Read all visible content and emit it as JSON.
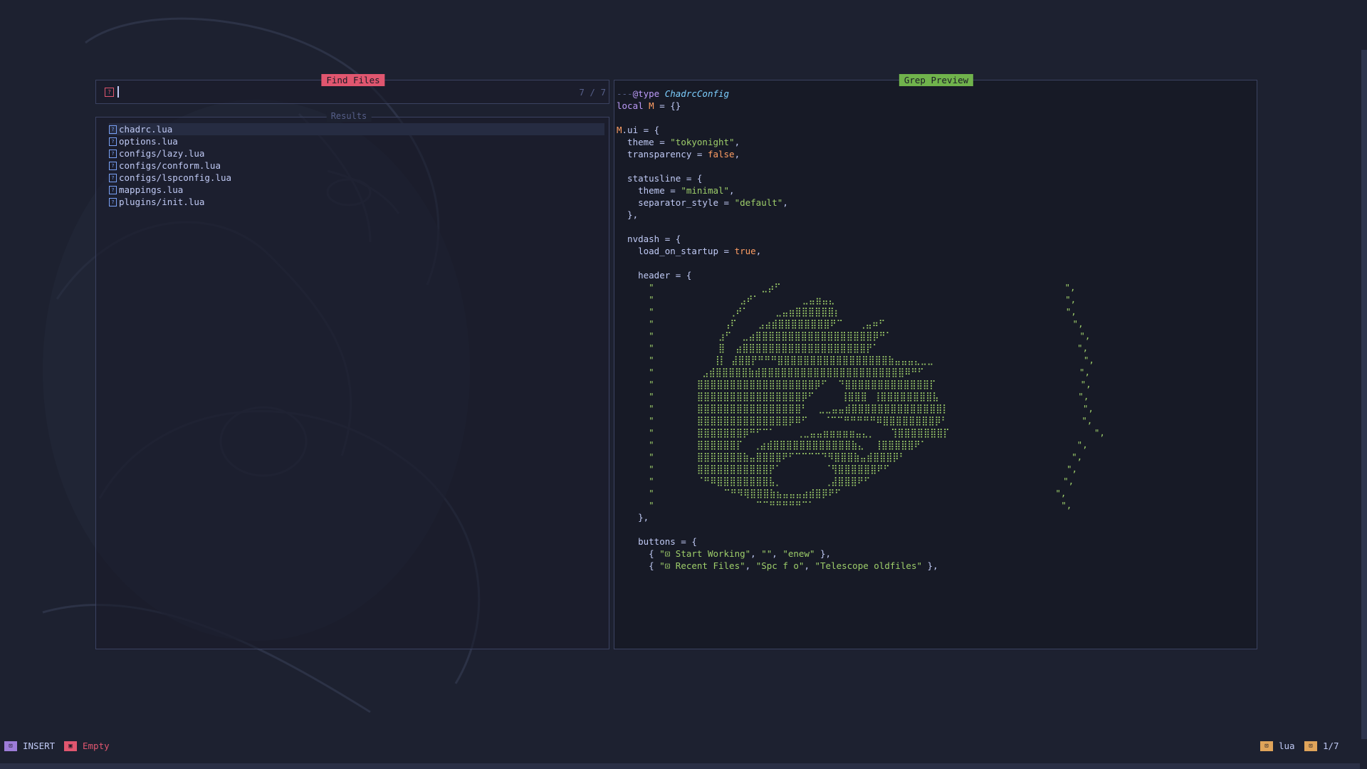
{
  "prompt": {
    "title": "Find Files",
    "count": "7 / 7",
    "icon": "search-icon"
  },
  "results": {
    "title": "Results",
    "items": [
      {
        "label": "chadrc.lua",
        "selected": true
      },
      {
        "label": "options.lua",
        "selected": false
      },
      {
        "label": "configs/lazy.lua",
        "selected": false
      },
      {
        "label": "configs/conform.lua",
        "selected": false
      },
      {
        "label": "configs/lspconfig.lua",
        "selected": false
      },
      {
        "label": "mappings.lua",
        "selected": false
      },
      {
        "label": "plugins/init.lua",
        "selected": false
      }
    ]
  },
  "preview": {
    "title": "Grep Preview",
    "lines": [
      [
        {
          "t": "---",
          "c": "com"
        },
        {
          "t": "@type ",
          "c": "kw"
        },
        {
          "t": "ChadrcConfig",
          "c": "typ"
        }
      ],
      [
        {
          "t": "local ",
          "c": "kw"
        },
        {
          "t": "M",
          "c": "var"
        },
        {
          "t": " = {}",
          "c": ""
        }
      ],
      [],
      [
        {
          "t": "M",
          "c": "var"
        },
        {
          "t": ".ui = {",
          "c": ""
        }
      ],
      [
        {
          "t": "  theme = ",
          "c": ""
        },
        {
          "t": "\"tokyonight\"",
          "c": "str"
        },
        {
          "t": ",",
          "c": ""
        }
      ],
      [
        {
          "t": "  transparency = ",
          "c": ""
        },
        {
          "t": "false",
          "c": "const"
        },
        {
          "t": ",",
          "c": ""
        }
      ],
      [],
      [
        {
          "t": "  statusline = {",
          "c": ""
        }
      ],
      [
        {
          "t": "    theme = ",
          "c": ""
        },
        {
          "t": "\"minimal\"",
          "c": "str"
        },
        {
          "t": ",",
          "c": ""
        }
      ],
      [
        {
          "t": "    separator_style = ",
          "c": ""
        },
        {
          "t": "\"default\"",
          "c": "str"
        },
        {
          "t": ",",
          "c": ""
        }
      ],
      [
        {
          "t": "  },",
          "c": ""
        }
      ],
      [],
      [
        {
          "t": "  nvdash = {",
          "c": ""
        }
      ],
      [
        {
          "t": "    load_on_startup = ",
          "c": ""
        },
        {
          "t": "true",
          "c": "const"
        },
        {
          "t": ",",
          "c": ""
        }
      ],
      [],
      [
        {
          "t": "    header = {",
          "c": ""
        }
      ],
      [
        {
          "t": "      \"                    ⣀⡴⠋                                                     \",",
          "c": "art"
        }
      ],
      [
        {
          "t": "      \"                ⣠⠞⠁        ⣀⣤⣶⣤⣄                                           \",",
          "c": "art"
        }
      ],
      [
        {
          "t": "      \"              ⢀⠞⠁     ⣀⣤⣶⣿⣿⣿⣿⣿⣿⡆                                          \",",
          "c": "art"
        }
      ],
      [
        {
          "t": "      \"             ⢠⠏    ⣠⣴⣾⣿⣿⣿⣿⣿⣿⣿⣿⠟⠉   ⢀⣤⠶⠋                                   \",",
          "c": "art"
        }
      ],
      [
        {
          "t": "      \"            ⣰⠋  ⣀⣴⣿⣿⣿⣿⣿⣿⣿⣿⣿⣿⣿⣿⣿⣿⣿⣿⣿⣿⡿⠛⠁                                   \",",
          "c": "art"
        }
      ],
      [
        {
          "t": "      \"            ⣿  ⣴⣿⣿⣿⣿⣿⣿⣿⣿⣿⣿⣿⣿⣿⣿⣿⣿⣿⣿⣿⡟⠁                                     \",",
          "c": "art"
        }
      ],
      [
        {
          "t": "      \"           ⢸⡇ ⣼⣿⣿⡟⠛⠛⠛⣿⣿⣿⣿⣿⣿⣿⣿⣿⣿⣿⣿⣿⣿⣿⣿⣿⣷⣤⣤⣤⣄⣀⣀                            \",",
          "c": "art"
        }
      ],
      [
        {
          "t": "      \"         ⣠⣾⣿⣿⣿⣿⣿⣷⣾⣿⣿⣿⣿⣿⣿⣿⣿⣿⣿⣿⣿⣿⣿⣿⣿⣿⣿⣿⣿⣿⣿⠿⠛⠋                             \",",
          "c": "art"
        }
      ],
      [
        {
          "t": "      \"        ⣿⣿⣿⣿⣿⣿⣿⣿⣿⣿⣿⣿⣿⣿⣿⣿⣿⣿⡿⠋  ⠙⣿⣿⣿⣿⣿⣿⣿⣿⣿⣿⣿⣿⣿⡏                           \",",
          "c": "art"
        }
      ],
      [
        {
          "t": "      \"        ⣿⣿⣿⣿⣿⣿⣿⣿⣿⣿⣿⣿⣿⣿⣿⣿⡿⠋     ⢸⣿⣿⣿⠀⢸⣿⣿⣿⣿⣿⣿⣿⣿⣧                          \",",
          "c": "art"
        }
      ],
      [
        {
          "t": "      \"        ⣿⣿⣿⣿⣿⣿⣿⣿⣿⣿⣿⣿⣿⣿⣿⣿⠃  ⣀⣀⣤⣤⣾⣿⣿⣿⣿⣿⣿⣿⣿⣿⣿⣿⣿⣿⣿⡇                         \",",
          "c": "art"
        }
      ],
      [
        {
          "t": "      \"        ⣿⣿⣿⣿⣿⣿⣿⣿⣿⣿⣿⣿⣿⣿⡿⠿⠋   ⠈⠉⠉⠛⠛⠛⠛⠛⠿⣿⣿⣿⣿⣿⣿⣿⣿⡿⠃                         \",",
          "c": "art"
        }
      ],
      [
        {
          "t": "      \"        ⣿⣿⣿⣿⣿⣿⣿⡿⠛⠋⠉⠁    ⢀⣀⣤⣤⣶⣶⣶⣶⣶⣤⣄⡀   ⢹⣿⣿⣿⣿⣿⣿⣿⡏                           \",",
          "c": "art"
        }
      ],
      [
        {
          "t": "      \"        ⣿⣿⣿⣿⣿⣿⡏  ⢀⣴⣾⣿⣿⣿⣿⣿⣿⣿⣿⣿⣿⣿⣿⣷⣄  ⢸⣿⣿⣿⣿⣿⠟⠁                            \",",
          "c": "art"
        }
      ],
      [
        {
          "t": "      \"        ⣿⣿⣿⣿⣿⣿⣿⣷⣤⣿⣿⣿⣿⠟⠋⠉⠉⠉⠉⠙⠻⣿⣿⣿⣷⣤⣾⣿⣿⣿⡿⠃                               \",",
          "c": "art"
        }
      ],
      [
        {
          "t": "      \"        ⣿⣿⣿⣿⣿⣿⣿⣿⣿⣿⣿⡟⠁        ⠈⢻⣿⣿⣿⣿⣿⣿⠟⠋                                 \",",
          "c": "art"
        }
      ],
      [
        {
          "t": "      \"        ⠈⠛⠿⣿⣿⣿⣿⣿⣿⣿⣿⣧⡀        ⢀⣼⣿⣿⣿⠟⠋                                    \",",
          "c": "art"
        }
      ],
      [
        {
          "t": "      \"             ⠉⠛⠻⢿⣿⣿⣿⣷⣦⣤⣤⣤⣴⣾⣿⡿⠟⠋                                        \",",
          "c": "art"
        }
      ],
      [
        {
          "t": "      \"                   ⠉⠉⠛⠛⠛⠛⠛⠉⠁                                              \",",
          "c": "art"
        }
      ],
      [
        {
          "t": "    },",
          "c": ""
        }
      ],
      [],
      [
        {
          "t": "    buttons = {",
          "c": ""
        }
      ],
      [
        {
          "t": "      { ",
          "c": ""
        },
        {
          "t": "\"⊡ Start Working\"",
          "c": "str"
        },
        {
          "t": ", ",
          "c": ""
        },
        {
          "t": "\"\"",
          "c": "str"
        },
        {
          "t": ", ",
          "c": ""
        },
        {
          "t": "\"enew\"",
          "c": "str"
        },
        {
          "t": " },",
          "c": ""
        }
      ],
      [
        {
          "t": "      { ",
          "c": ""
        },
        {
          "t": "\"⊡ Recent Files\"",
          "c": "str"
        },
        {
          "t": ", ",
          "c": ""
        },
        {
          "t": "\"Spc f o\"",
          "c": "str"
        },
        {
          "t": ", ",
          "c": ""
        },
        {
          "t": "\"Telescope oldfiles\"",
          "c": "str"
        },
        {
          "t": " },",
          "c": ""
        }
      ]
    ]
  },
  "statusline": {
    "mode": "INSERT",
    "buffer": "Empty",
    "filetype": "lua",
    "position": "1/7",
    "colors": {
      "mode": "#9d7cd8",
      "buffer": "#e0566f",
      "filetype": "#e0a45a"
    }
  },
  "colors": {
    "background": "#1d2130",
    "prompt_title": "#e0566f",
    "preview_title": "#70b34c",
    "border": "#3b4261"
  }
}
